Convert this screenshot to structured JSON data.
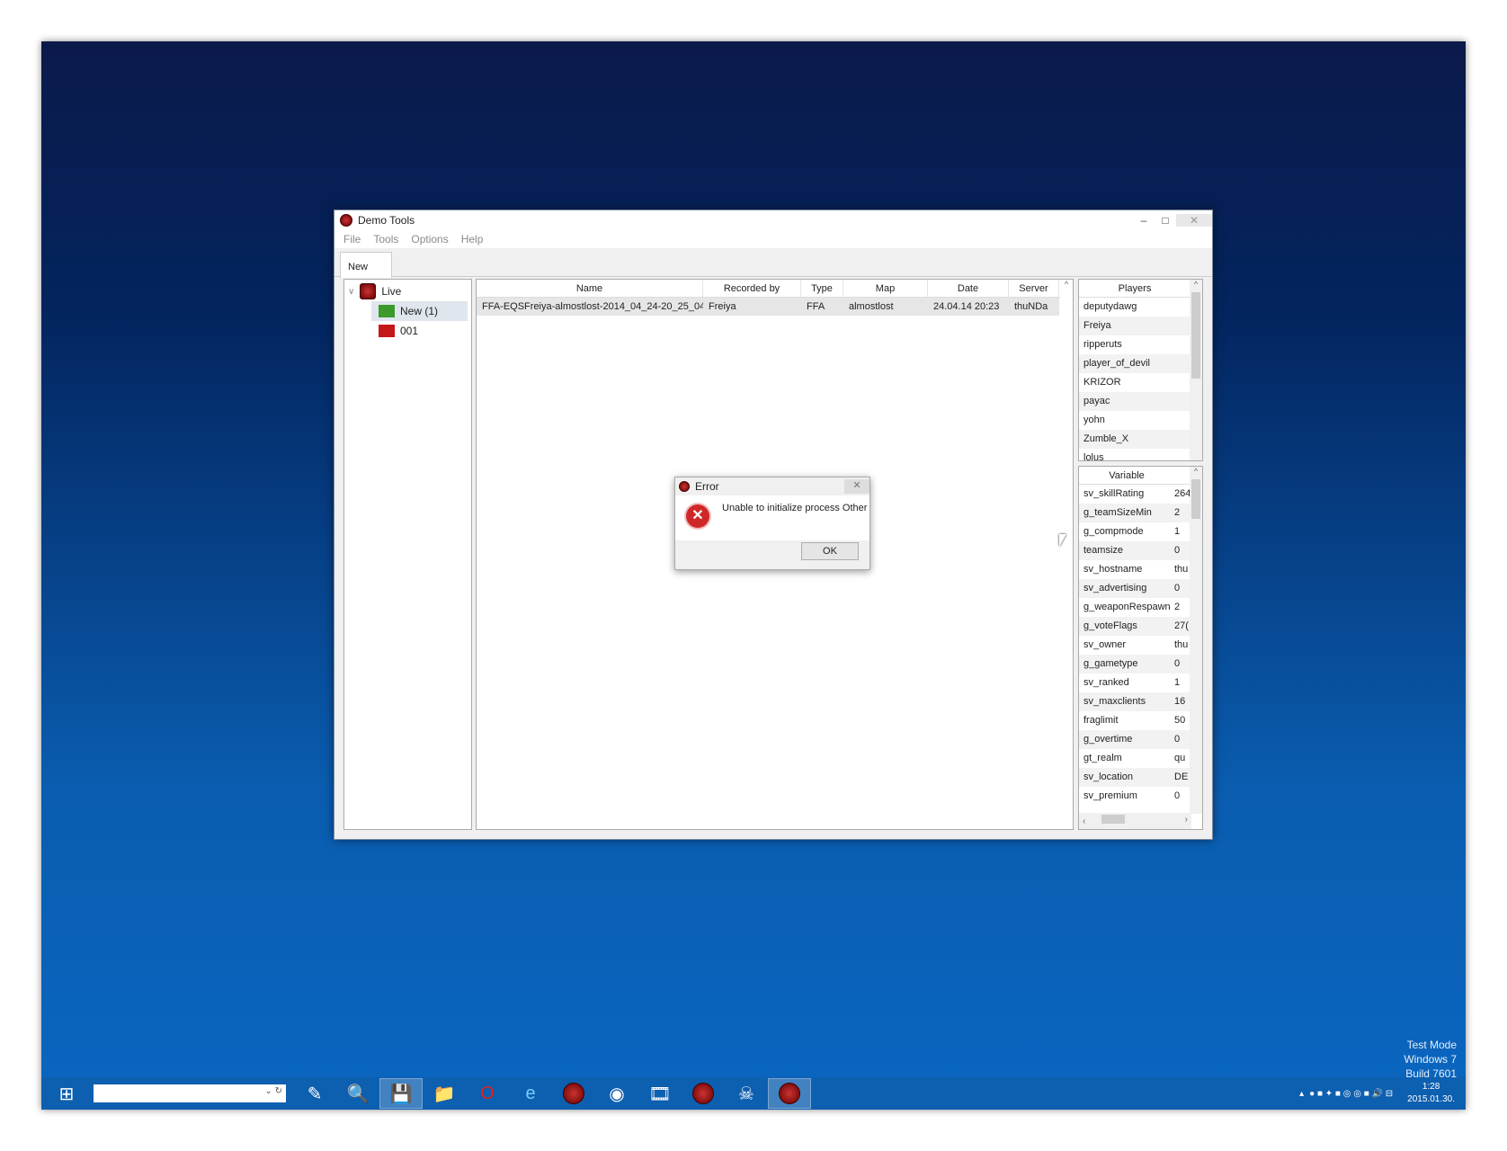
{
  "window": {
    "title": "Demo Tools",
    "menu": [
      "File",
      "Tools",
      "Options",
      "Help"
    ],
    "tab": "New"
  },
  "tree": {
    "root": "Live",
    "items": [
      "New (1)",
      "001"
    ],
    "colors": {
      "new": "#3a9a2a",
      "001": "#c41818"
    }
  },
  "list": {
    "columns": [
      "Name",
      "Recorded by",
      "Type",
      "Map",
      "Date",
      "Server"
    ],
    "rows": [
      {
        "name": "FFA-EQSFreiya-almostlost-2014_04_24-20_25_04",
        "recorded_by": "Freiya",
        "type": "FFA",
        "map": "almostlost",
        "date": "24.04.14 20:23",
        "server": "thuNDa"
      }
    ]
  },
  "players": {
    "header": "Players",
    "items": [
      "deputydawg",
      "Freiya",
      "ripperuts",
      "player_of_devil",
      "KRIZOR",
      "payac",
      "yohn",
      "Zumble_X",
      "lolus"
    ]
  },
  "variables": {
    "header": "Variable",
    "rows": [
      [
        "sv_skillRating",
        "264"
      ],
      [
        "g_teamSizeMin",
        "2"
      ],
      [
        "g_compmode",
        "1"
      ],
      [
        "teamsize",
        "0"
      ],
      [
        "sv_hostname",
        "thu"
      ],
      [
        "sv_advertising",
        "0"
      ],
      [
        "g_weaponRespawn",
        "2"
      ],
      [
        "g_voteFlags",
        "27("
      ],
      [
        "sv_owner",
        "thu"
      ],
      [
        "g_gametype",
        "0"
      ],
      [
        "sv_ranked",
        "1"
      ],
      [
        "sv_maxclients",
        "16"
      ],
      [
        "fraglimit",
        "50"
      ],
      [
        "g_overtime",
        "0"
      ],
      [
        "gt_realm",
        "qu"
      ],
      [
        "sv_location",
        "DE"
      ],
      [
        "sv_premium",
        "0"
      ]
    ]
  },
  "dialog": {
    "title": "Error",
    "message": "Unable to initialize process Other",
    "ok": "OK"
  },
  "desktop": {
    "watermark": [
      "Test Mode",
      "Windows 7",
      "Build 7601"
    ],
    "clock_time": "1:28",
    "clock_date": "2015.01.30."
  }
}
